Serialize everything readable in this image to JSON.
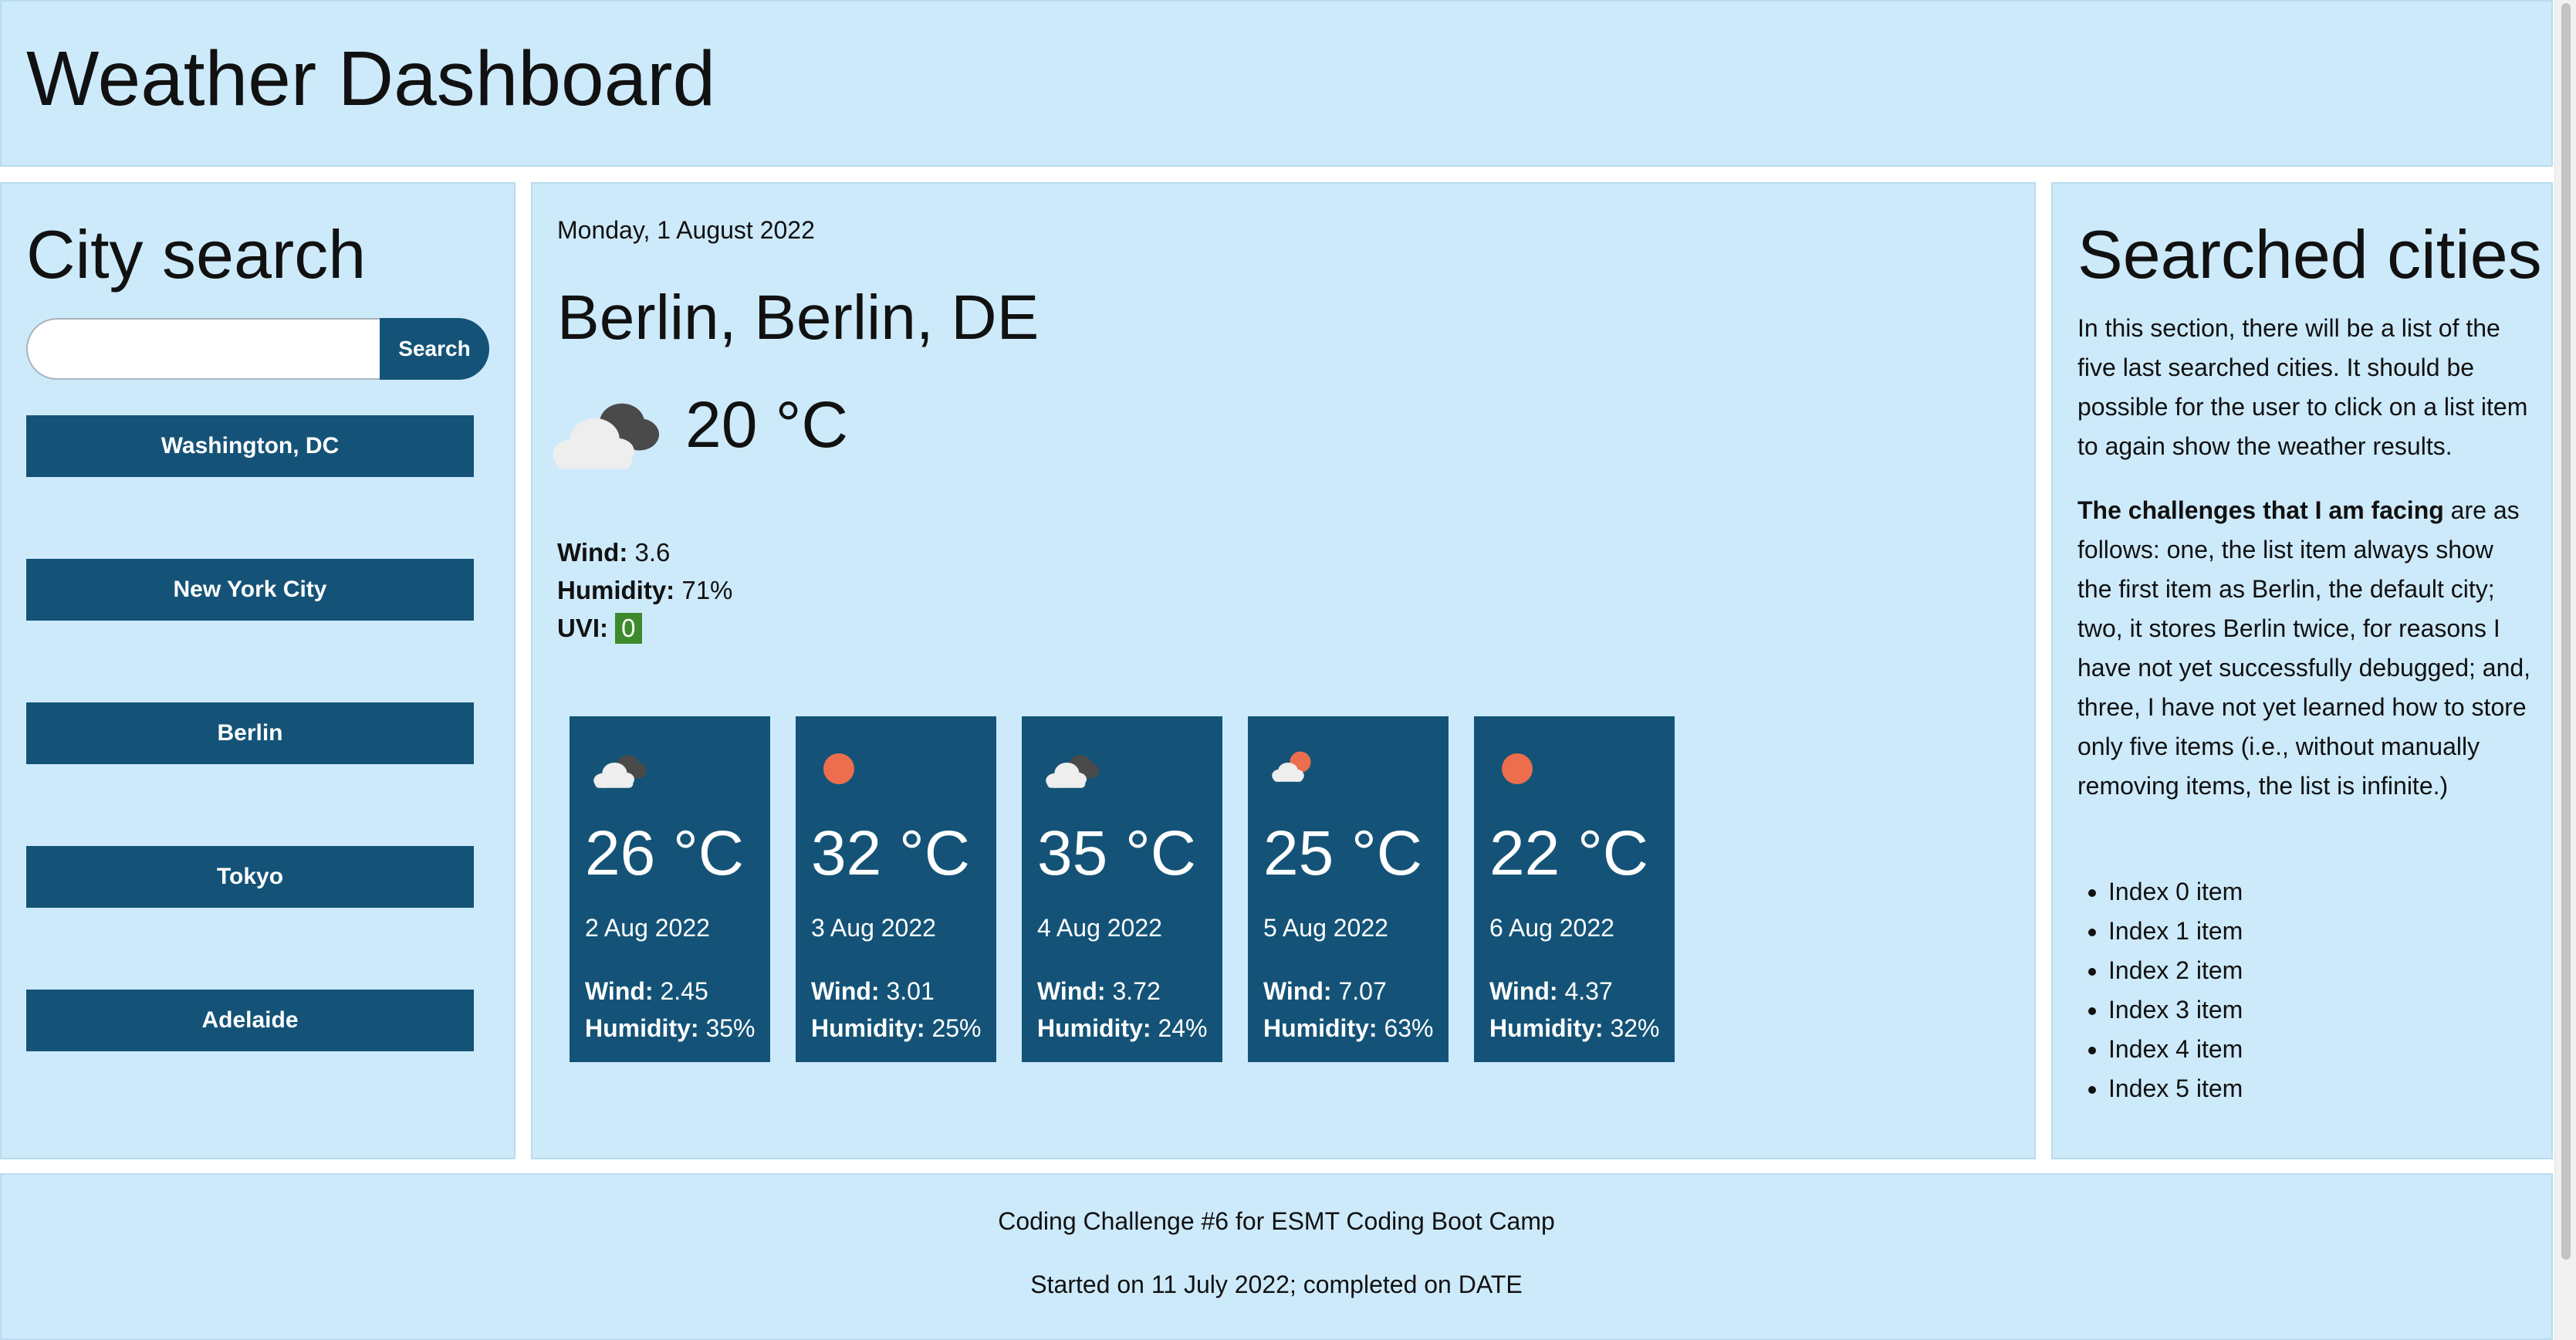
{
  "header": {
    "title": "Weather Dashboard"
  },
  "search_panel": {
    "title": "City search",
    "search_input": {
      "value": "",
      "placeholder": ""
    },
    "search_button_label": "Search",
    "cities": [
      "Washington, DC",
      "New York City",
      "Berlin",
      "Tokyo",
      "Adelaide"
    ]
  },
  "current": {
    "date": "Monday, 1 August 2022",
    "city": "Berlin, Berlin, DE",
    "icon": "broken-clouds-icon",
    "temperature": "20 °C",
    "wind_label": "Wind:",
    "wind_value": "3.6",
    "humidity_label": "Humidity:",
    "humidity_value": "71%",
    "uvi_label": "UVI:",
    "uvi_value": "0",
    "uvi_color": "#3c8a2c"
  },
  "forecast": [
    {
      "icon": "broken-clouds-icon",
      "temperature": "26 °C",
      "date": "2 Aug 2022",
      "wind_label": "Wind:",
      "wind": "2.45",
      "humidity_label": "Humidity:",
      "humidity": "35%"
    },
    {
      "icon": "clear-sky-icon",
      "temperature": "32 °C",
      "date": "3 Aug 2022",
      "wind_label": "Wind:",
      "wind": "3.01",
      "humidity_label": "Humidity:",
      "humidity": "25%"
    },
    {
      "icon": "broken-clouds-icon",
      "temperature": "35 °C",
      "date": "4 Aug 2022",
      "wind_label": "Wind:",
      "wind": "3.72",
      "humidity_label": "Humidity:",
      "humidity": "24%"
    },
    {
      "icon": "few-clouds-icon",
      "temperature": "25 °C",
      "date": "5 Aug 2022",
      "wind_label": "Wind:",
      "wind": "7.07",
      "humidity_label": "Humidity:",
      "humidity": "63%"
    },
    {
      "icon": "clear-sky-icon",
      "temperature": "22 °C",
      "date": "6 Aug 2022",
      "wind_label": "Wind:",
      "wind": "4.37",
      "humidity_label": "Humidity:",
      "humidity": "32%"
    }
  ],
  "history_panel": {
    "title": "Searched cities",
    "intro": "In this section, there will be a list of the five last searched cities. It should be possible for the user to click on a list item to again show the weather results.",
    "challenges_bold": "The challenges that I am facing",
    "challenges_text": " are as follows: one, the list item always show the first item as Berlin, the default city; two, it stores Berlin twice, for reasons I have not yet successfully debugged; and, three, I have not yet learned how to store only five items (i.e., without manually removing items, the list is infinite.)",
    "items": [
      "Index 0 item",
      "Index 1 item",
      "Index 2 item",
      "Index 3 item",
      "Index 4 item",
      "Index 5 item"
    ]
  },
  "footer": {
    "line1": "Coding Challenge #6 for ESMT Coding Boot Camp",
    "line2": "Started on 11 July 2022; completed on DATE"
  },
  "colors": {
    "panel_background": "#cdeafb",
    "button_background": "#145377",
    "sun": "#ec6e4c",
    "cloud_light": "#eeeeee",
    "cloud_dark": "#4a4a4a"
  }
}
